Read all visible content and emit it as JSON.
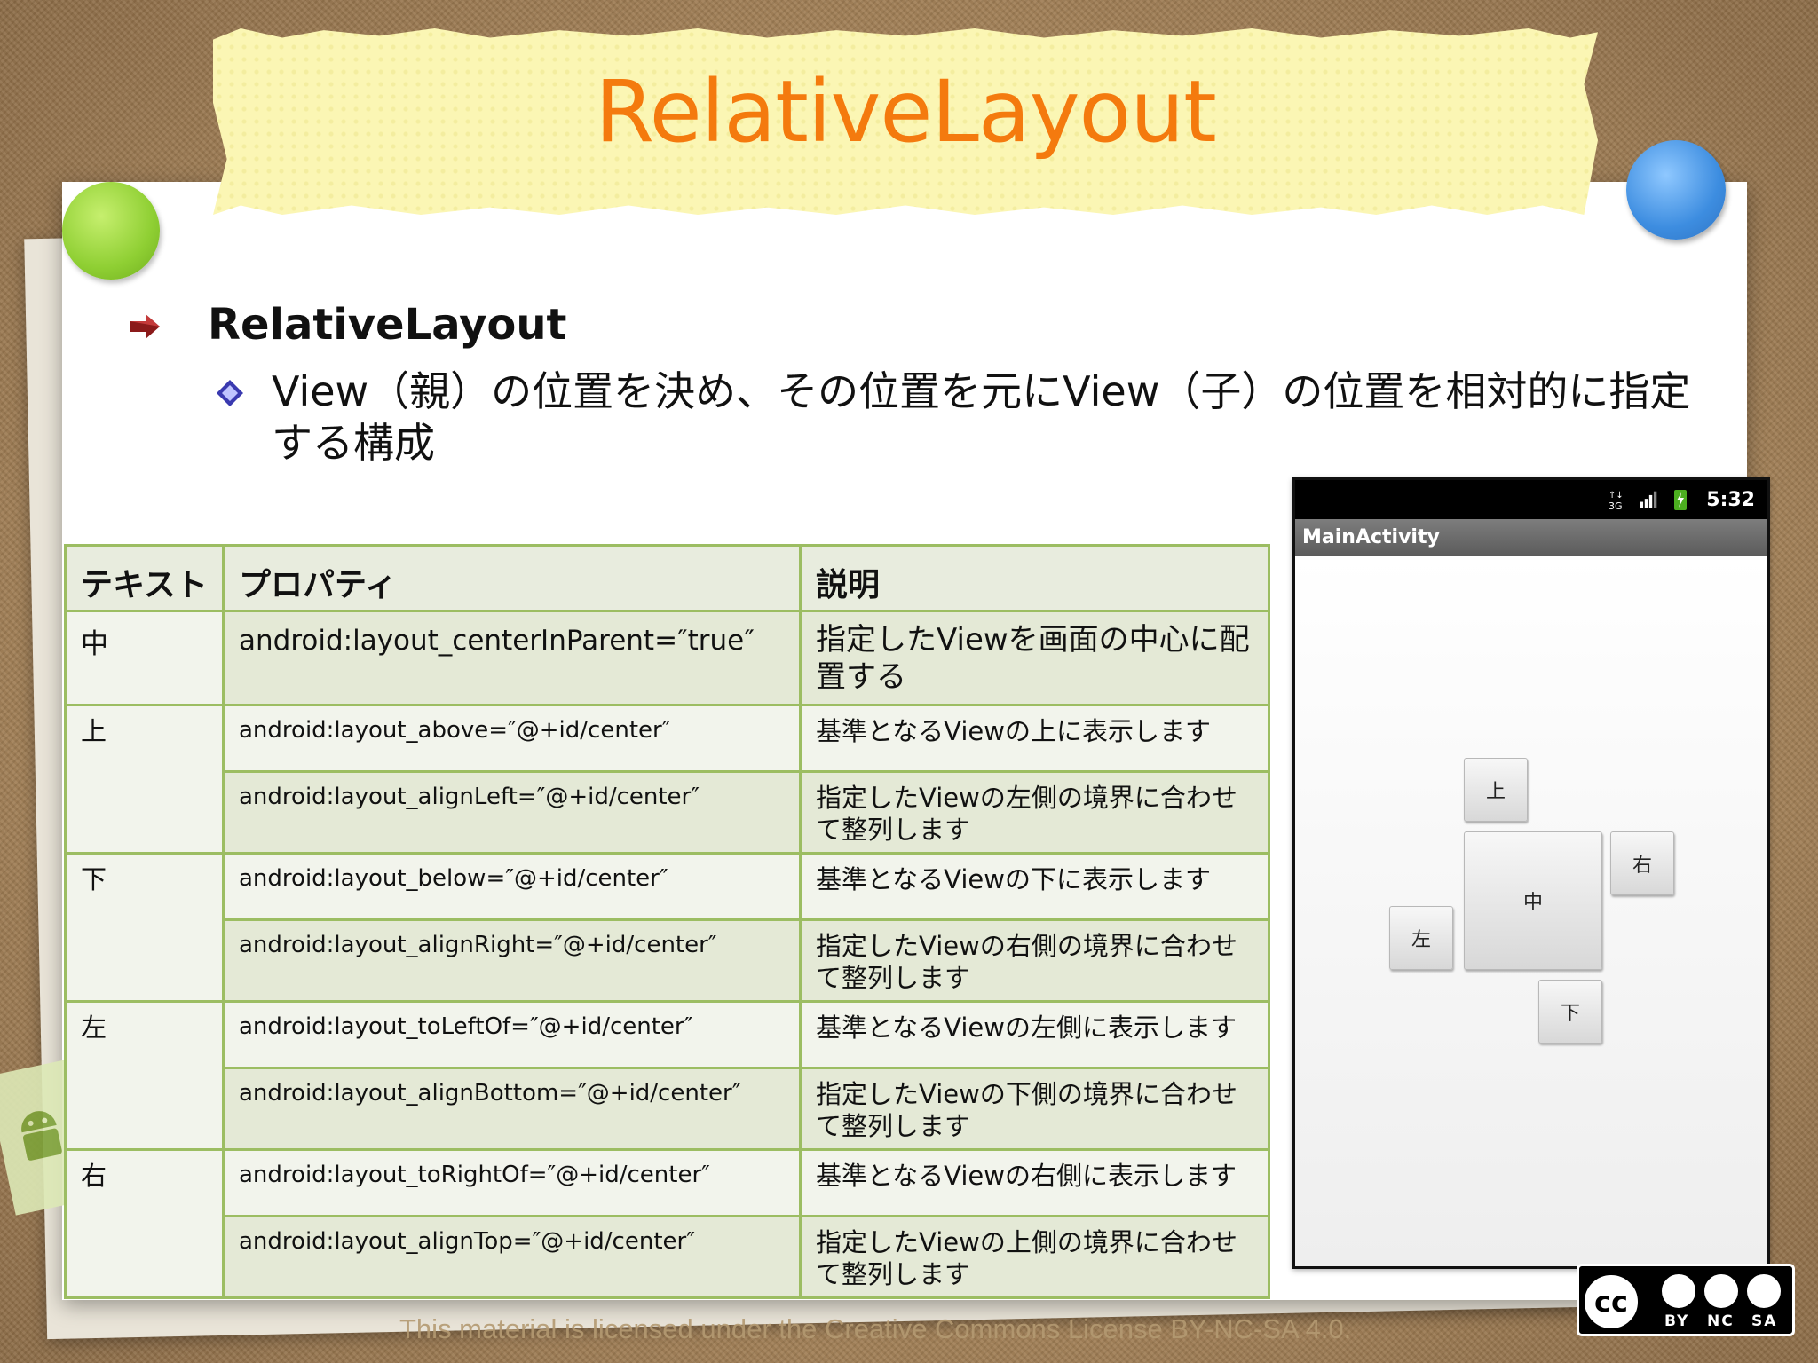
{
  "slide": {
    "title": "RelativeLayout",
    "bullet1": "RelativeLayout",
    "bullet2": "View（親）の位置を決め、その位置を元にView（子）の位置を相対的に指定する構成"
  },
  "table": {
    "headers": [
      "テキスト",
      "プロパティ",
      "説明"
    ],
    "rows": [
      {
        "text": "中",
        "property": "android:layout_centerInParent=″true″",
        "desc": "指定したViewを画面の中心に配置する"
      },
      {
        "text": "上",
        "property": "android:layout_above=″@+id/center″",
        "desc": "基準となるViewの上に表示します"
      },
      {
        "text": "",
        "property": "android:layout_alignLeft=″@+id/center″",
        "desc": "指定したViewの左側の境界に合わせて整列します"
      },
      {
        "text": "下",
        "property": "android:layout_below=″@+id/center″",
        "desc": "基準となるViewの下に表示します"
      },
      {
        "text": "",
        "property": "android:layout_alignRight=″@+id/center″",
        "desc": "指定したViewの右側の境界に合わせて整列します"
      },
      {
        "text": "左",
        "property": "android:layout_toLeftOf=″@+id/center″",
        "desc": "基準となるViewの左側に表示します"
      },
      {
        "text": "",
        "property": "android:layout_alignBottom=″@+id/center″",
        "desc": "指定したViewの下側の境界に合わせて整列します"
      },
      {
        "text": "右",
        "property": "android:layout_toRightOf=″@+id/center″",
        "desc": "基準となるViewの右側に表示します"
      },
      {
        "text": "",
        "property": "android:layout_alignTop=″@+id/center″",
        "desc": "指定したViewの上側の境界に合わせて整列します"
      }
    ]
  },
  "phone": {
    "time": "5:32",
    "app_title": "MainActivity",
    "buttons": {
      "top": "上",
      "center": "中",
      "right": "右",
      "left": "左",
      "bottom": "下"
    }
  },
  "footer": {
    "license_text": "This material is licensed under the Creative Commons License BY-NC-SA 4.0.",
    "cc_label": "cc",
    "cc_by": "BY",
    "cc_nc": "NC",
    "cc_sa": "SA"
  },
  "colors": {
    "title": "#f47a0e",
    "table_border": "#9cbd62",
    "bullet_arrow": "#8b1a1a",
    "bullet_diamond": "#3a3ab0"
  }
}
